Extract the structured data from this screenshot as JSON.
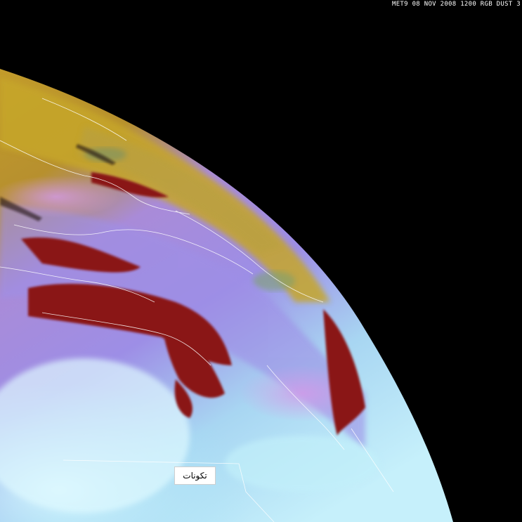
{
  "image": {
    "header_text": "MET9 08 NOV 2008 1200 RGB DUST 3",
    "annotation_label": "تكونات",
    "background_color": "#000000",
    "palette": {
      "space": "#000000",
      "yellow_high": "#c9a22a",
      "magenta_surface": "#b88ce0",
      "dust_red": "#8a1418",
      "cyan_desert": "#b8eef8",
      "coastline": "#ffffff"
    }
  }
}
